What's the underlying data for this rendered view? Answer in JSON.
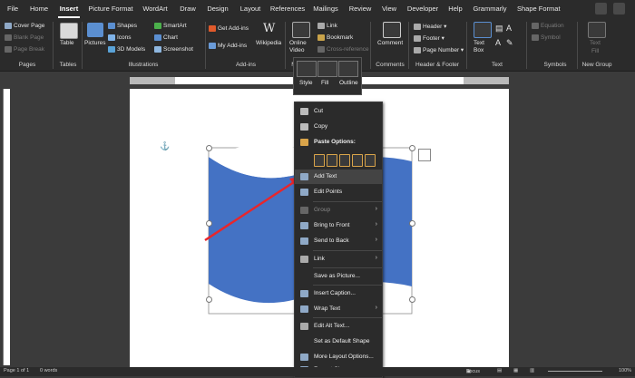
{
  "tabs": [
    "File",
    "Home",
    "Insert",
    "Picture Format",
    "WordArt",
    "Draw",
    "Design",
    "Layout",
    "References",
    "Mailings",
    "Review",
    "View",
    "Developer",
    "Help",
    "Grammarly",
    "Shape Format"
  ],
  "active_tab": "Insert",
  "ribbon": {
    "pages": {
      "cover_page": "Cover Page",
      "blank_page": "Blank Page",
      "page_break": "Page Break",
      "label": "Pages"
    },
    "tables": {
      "table": "Table",
      "label": "Tables"
    },
    "illustrations": {
      "pictures": "Pictures",
      "shapes": "Shapes",
      "icons": "Icons",
      "models_3d": "3D Models",
      "smartart": "SmartArt",
      "chart": "Chart",
      "screenshot": "Screenshot",
      "label": "Illustrations"
    },
    "addins": {
      "get_addins": "Get Add-ins",
      "my_addins": "My Add-ins",
      "wikipedia": "Wikipedia",
      "label": "Add-ins"
    },
    "media": {
      "online_video": "Online Video",
      "label": "M"
    },
    "links": {
      "link": "Link",
      "bookmark": "Bookmark",
      "cross_reference": "Cross-reference"
    },
    "comments": {
      "comment": "Comment",
      "label": "Comments"
    },
    "header_footer": {
      "header": "Header",
      "footer": "Footer",
      "page_number": "Page Number",
      "label": "Header & Footer"
    },
    "text": {
      "text_box": "Text Box",
      "label": "Text"
    },
    "symbols": {
      "equation": "Equation",
      "symbol": "Symbol",
      "label": "Symbols"
    },
    "new_group": {
      "text": "Text",
      "fill": "Fill",
      "label": "New Group"
    }
  },
  "mini_toolbar": {
    "style": "Style",
    "fill": "Fill",
    "outline": "Outline"
  },
  "context_menu": {
    "cut": "Cut",
    "copy": "Copy",
    "paste_options": "Paste Options:",
    "add_text": "Add Text",
    "edit_points": "Edit Points",
    "group": "Group",
    "bring_to_front": "Bring to Front",
    "send_to_back": "Send to Back",
    "link": "Link",
    "save_as_picture": "Save as Picture...",
    "insert_caption": "Insert Caption...",
    "wrap_text": "Wrap Text",
    "edit_alt_text": "Edit Alt Text...",
    "set_default_shape": "Set as Default Shape",
    "more_layout_options": "More Layout Options...",
    "format_shape": "Format Shape..."
  },
  "status": {
    "page": "Page 1 of 1",
    "words": "0 words",
    "focus": "Focus",
    "zoom": "100%"
  },
  "colors": {
    "shape_fill": "#4472c4",
    "arrow": "#e8262b",
    "ribbon_bg": "#2b2b2b",
    "workspace": "#3b3b3b"
  }
}
